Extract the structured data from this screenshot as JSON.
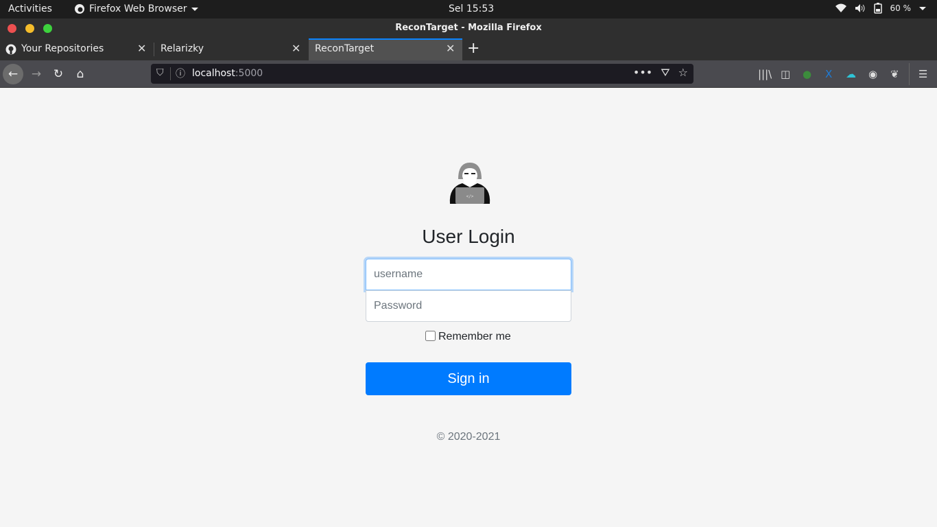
{
  "system": {
    "activities": "Activities",
    "app_menu": "Firefox Web Browser",
    "clock": "Sel 15:53",
    "battery": "60 %"
  },
  "window": {
    "title": "ReconTarget - Mozilla Firefox"
  },
  "tabs": [
    {
      "label": "Your Repositories",
      "icon": "github-icon"
    },
    {
      "label": "Relarizky"
    },
    {
      "label": "ReconTarget",
      "active": true
    }
  ],
  "navbar": {
    "url_host": "localhost",
    "url_port": ":5000"
  },
  "page": {
    "heading": "User Login",
    "username_placeholder": "username",
    "password_placeholder": "Password",
    "remember_label": "Remember me",
    "signin_label": "Sign in",
    "footer": "© 2020-2021",
    "accent_color": "#007bff"
  }
}
